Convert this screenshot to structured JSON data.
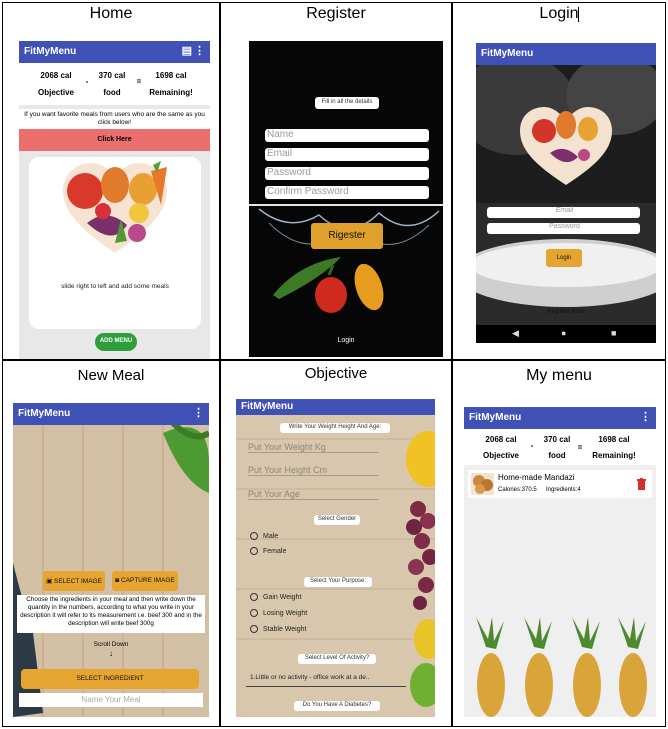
{
  "cells": {
    "home": "Home",
    "register": "Register",
    "login": "Login",
    "new_meal": "New Meal",
    "objective": "Objective",
    "my_menu": "My menu"
  },
  "app": {
    "name": "FitMyMenu"
  },
  "calories": {
    "objective_value": "2068 cal",
    "objective_label": "Objective",
    "food_value": "370 cal",
    "food_label": "food",
    "remaining_value": "1698 cal",
    "remaining_label": "Remaining!",
    "minus": "-",
    "equals": "="
  },
  "home": {
    "favorites_text": "If you want favorite meals from users who are the same as you click below!",
    "click_here": "Click Here",
    "slide_hint": "slide right to left and add some meals",
    "add_menu": "ADD MENU"
  },
  "register": {
    "header": "Fill in all the details",
    "name_placeholder": "Name",
    "email_placeholder": "Email",
    "password_placeholder": "Password",
    "confirm_placeholder": "Confirm Password",
    "submit": "Rigester",
    "login_link": "Login"
  },
  "login": {
    "email_placeholder": "Email",
    "password_placeholder": "Password",
    "submit": "Login",
    "register_link": "Register Now!"
  },
  "new_meal": {
    "select_image": "SELECT IMAGE",
    "capture_image": "CAPTURE IMAGE",
    "instructions": "Choose the ingredients in your meal and then write down the quantity in the numbers, according to what you write in your description it will refer to its measurement i.e. beef 300 and in the description will write beef 300g",
    "scroll_down": "Scroll Down",
    "select_ingredient": "SELECT INGREDIENT",
    "name_placeholder": "Name Your Meal"
  },
  "objective": {
    "header": "Write Your Weight Height And Age:",
    "weight_placeholder": "Put Your Weight Kg",
    "height_placeholder": "Put Your Height Cm",
    "age_placeholder": "Put Your Age",
    "gender_header": "Select Gender",
    "male": "Male",
    "female": "Female",
    "purpose_header": "Select Your Purpose:",
    "gain": "Gain Weight",
    "losing": "Losing Weight",
    "stable": "Stable Weight",
    "activity_header": "Select Level Of Activity?",
    "activity_value": "1.Little or no activity - office work at a de..",
    "diabetes_header": "Do You Have A Diabetes?"
  },
  "my_menu": {
    "meal_name": "Home-made Mandazi",
    "meal_calories": "Calories:370.5",
    "meal_ingredients": "Ingredients:4"
  }
}
